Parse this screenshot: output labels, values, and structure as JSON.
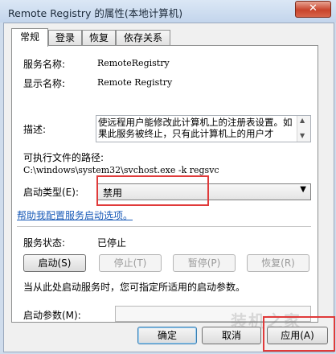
{
  "window": {
    "title": "Remote Registry 的属性(本地计算机)",
    "close_label": "✕"
  },
  "tabs": [
    {
      "label": "常规",
      "active": true
    },
    {
      "label": "登录",
      "active": false
    },
    {
      "label": "恢复",
      "active": false
    },
    {
      "label": "依存关系",
      "active": false
    }
  ],
  "general": {
    "service_name_label": "服务名称:",
    "service_name": "RemoteRegistry",
    "display_name_label": "显示名称:",
    "display_name": "Remote Registry",
    "description_label": "描述:",
    "description": "使远程用户能修改此计算机上的注册表设置。如果此服务被终止，只有此计算机上的用户才",
    "exe_path_label": "可执行文件的路径:",
    "exe_path": "C:\\windows\\system32\\svchost.exe -k regsvc",
    "startup_type_label": "启动类型(E):",
    "startup_type_value": "禁用",
    "help_link": "帮助我配置服务启动选项。",
    "status_label": "服务状态:",
    "status_value": "已停止",
    "start_button": "启动(S)",
    "stop_button": "停止(T)",
    "pause_button": "暂停(P)",
    "resume_button": "恢复(R)",
    "hint_text": "当从此处启动服务时，您可指定所适用的启动参数。",
    "start_params_label": "启动参数(M):",
    "start_params_value": ""
  },
  "footer": {
    "ok_button": "确定",
    "cancel_button": "取消",
    "apply_button": "应用(A)"
  },
  "colors": {
    "highlight_red": "#e03a3a",
    "link_blue": "#1a5bb8"
  }
}
